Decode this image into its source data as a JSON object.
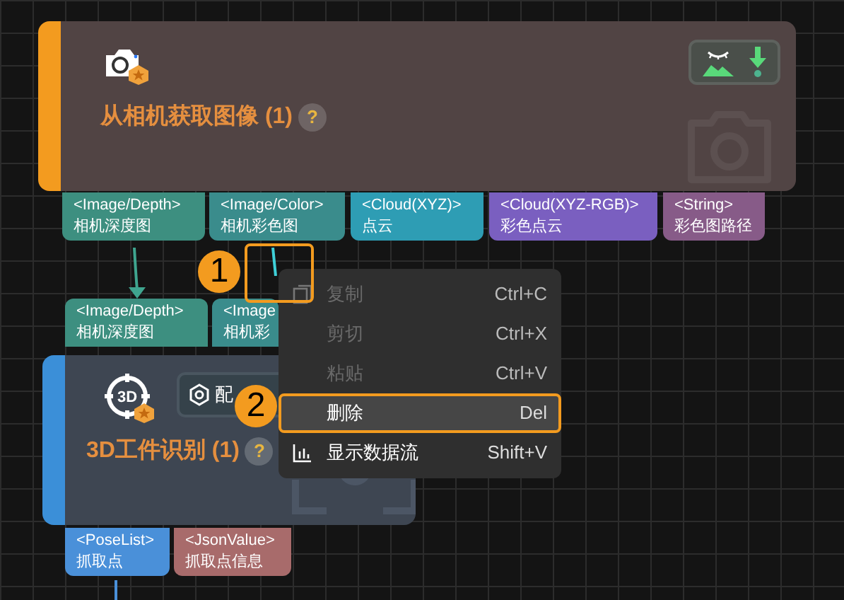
{
  "nodes": [
    {
      "title": "从相机获取图像",
      "count": "(1)",
      "help": "?",
      "color": "#f39b1f",
      "kind": "camera",
      "outputs": [
        {
          "type": "<Image/Depth>",
          "label": "相机深度图",
          "color": "#3d8f80"
        },
        {
          "type": "<Image/Color>",
          "label": "相机彩色图",
          "color": "#3a8c8c"
        },
        {
          "type": "<Cloud(XYZ)>",
          "label": "点云",
          "color": "#2e9db4"
        },
        {
          "type": "<Cloud(XYZ-RGB)>",
          "label": "彩色点云",
          "color": "#7a5fc0"
        },
        {
          "type": "<String>",
          "label": "彩色图路径",
          "color": "#875b88"
        }
      ]
    },
    {
      "title": "3D工件识别",
      "count": "(1)",
      "help": "?",
      "color": "#3b8fd8",
      "kind": "vision",
      "icon_label": "3D",
      "button": "配",
      "inputs": [
        {
          "type": "<Image/Depth>",
          "label": "相机深度图",
          "color": "#3d8f80"
        },
        {
          "type": "<Image",
          "label": "相机彩",
          "color": "#3a8c8c"
        }
      ],
      "outputs": [
        {
          "type": "<PoseList>",
          "label": "抓取点",
          "color": "#4a90d9"
        },
        {
          "type": "<JsonValue>",
          "label": "抓取点信息",
          "color": "#a86b6b"
        }
      ]
    }
  ],
  "context_menu": [
    {
      "label": "复制",
      "shortcut": "Ctrl+C",
      "disabled": true,
      "selected": false,
      "kind": "copy"
    },
    {
      "label": "剪切",
      "shortcut": "Ctrl+X",
      "disabled": true,
      "selected": false,
      "kind": "plain"
    },
    {
      "label": "粘贴",
      "shortcut": "Ctrl+V",
      "disabled": true,
      "selected": false,
      "kind": "plain"
    },
    {
      "label": "删除",
      "shortcut": "Del",
      "disabled": false,
      "selected": true,
      "kind": "plain"
    },
    {
      "label": "显示数据流",
      "shortcut": "Shift+V",
      "disabled": false,
      "selected": false,
      "kind": "chart"
    }
  ],
  "callouts": [
    "1",
    "2"
  ]
}
